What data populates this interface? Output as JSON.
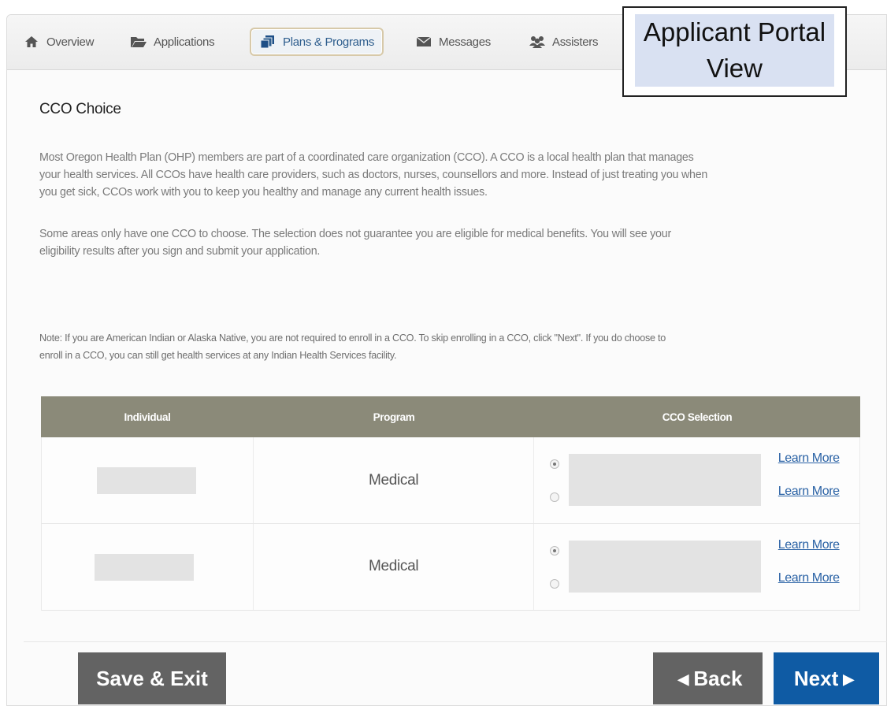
{
  "tabs": [
    {
      "label": "Overview",
      "icon": "home-icon"
    },
    {
      "label": "Applications",
      "icon": "folder-icon"
    },
    {
      "label": "Plans & Programs",
      "icon": "files-icon",
      "active": true
    },
    {
      "label": "Messages",
      "icon": "envelope-icon"
    },
    {
      "label": "Assisters",
      "icon": "users-icon"
    }
  ],
  "portal_label": {
    "line1": "Applicant Portal",
    "line2": "View"
  },
  "section_title": "CCO Choice",
  "intro_lines": [
    "Most Oregon Health Plan (OHP) members are part of a coordinated care organization (CCO). A CCO is a local health plan that manages",
    "your health services. All CCOs have health care providers, such as doctors, nurses, counsellors and more. Instead of just treating you when",
    "you get sick, CCOs work with you to keep you healthy and manage any current health issues."
  ],
  "eligibility_lines": [
    "Some areas only have one CCO to choose. The selection does not guarantee you are eligible for medical benefits. You will see your",
    "eligibility results after you sign and submit your application."
  ],
  "note_lines": [
    "Note: If you are American Indian or Alaska Native, you are not required to enroll in a CCO. To skip enrolling in a CCO, click \"Next\". If you do choose to",
    "enroll in a CCO, you can still get health services at any Indian Health Services facility."
  ],
  "table": {
    "headers": {
      "individual": "Individual",
      "program": "Program",
      "cco": "CCO Selection"
    },
    "rows": [
      {
        "program": "Medical",
        "learn_more": [
          "Learn More",
          "Learn More"
        ]
      },
      {
        "program": "Medical",
        "learn_more": [
          "Learn More",
          "Learn More"
        ]
      }
    ]
  },
  "buttons": {
    "save_exit": "Save & Exit",
    "back": "Back",
    "next": "Next"
  },
  "colors": {
    "header_bg": "#8b8a79",
    "next_bg": "#0f5ba4",
    "gray_btn": "#636363",
    "link": "#2a62a5"
  }
}
